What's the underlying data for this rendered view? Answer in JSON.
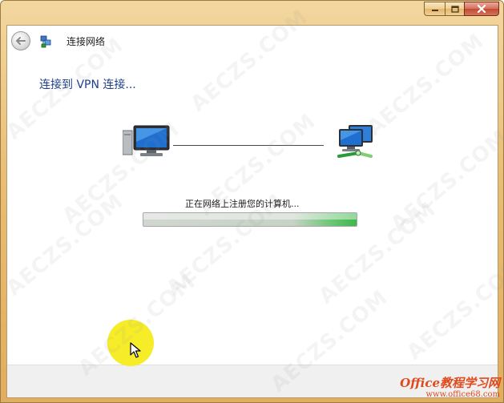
{
  "window": {
    "caption_buttons": {
      "minimize_icon": "minimize-icon",
      "maximize_icon": "maximize-icon",
      "close_icon": "close-icon"
    }
  },
  "nav": {
    "back_icon": "back-arrow-icon",
    "network_icon": "network-connection-icon",
    "title": "连接网络"
  },
  "content": {
    "heading": "连接到 VPN 连接...",
    "left_icon": "local-computer-icon",
    "right_icon": "remote-network-icon",
    "status_text": "正在网络上注册您的计算机...",
    "progress_fraction": 1.0
  },
  "watermark_text": "AECZS.COM",
  "brand": {
    "name": "Office教程学习网",
    "url": "www.office68.com"
  },
  "colors": {
    "title_bar": "#e9bd73",
    "heading": "#1e3f8a",
    "progress_green": "#3cb84a",
    "cursor_highlight": "#f5ec1c"
  }
}
